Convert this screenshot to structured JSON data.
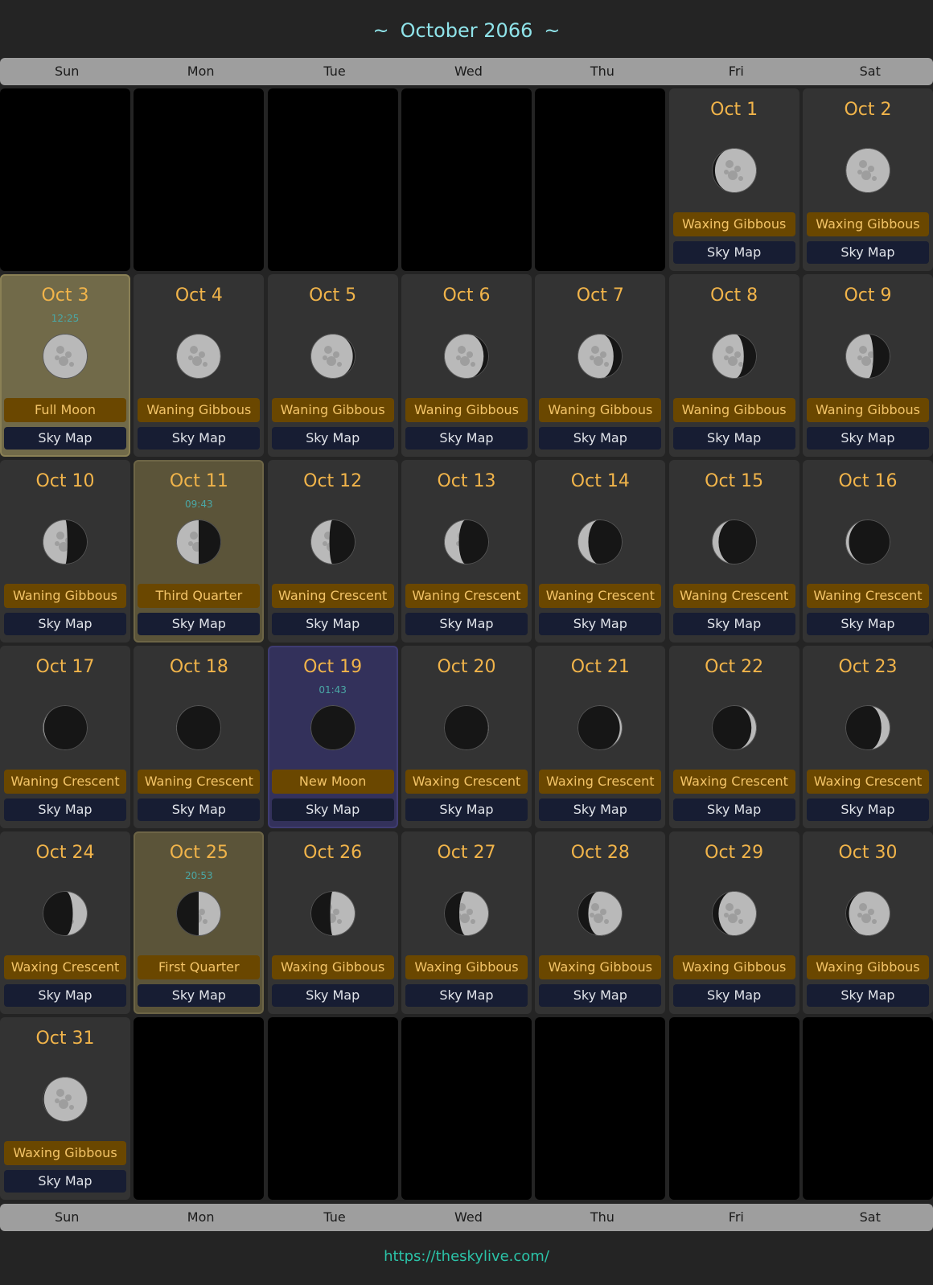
{
  "title": "October 2066",
  "title_deco": "~",
  "weekdays": [
    "Sun",
    "Mon",
    "Tue",
    "Wed",
    "Thu",
    "Fri",
    "Sat"
  ],
  "sky_map_label": "Sky Map",
  "footer_link": "https://theskylive.com/",
  "colors": {
    "date": "#f1b44a",
    "phase_bg": "#6a4700",
    "skymap_bg": "#171d33",
    "title": "#8fe3e9",
    "link": "#2bc3a8"
  },
  "leading_empty": 5,
  "trailing_empty": 6,
  "days": [
    {
      "date": "Oct 1",
      "phase": "Waxing Gibbous",
      "illum": 0.93,
      "waxing": true
    },
    {
      "date": "Oct 2",
      "phase": "Waxing Gibbous",
      "illum": 0.98,
      "waxing": true
    },
    {
      "date": "Oct 3",
      "phase": "Full Moon",
      "time": "12:25",
      "illum": 1.0,
      "waxing": true,
      "highlight": "full"
    },
    {
      "date": "Oct 4",
      "phase": "Waning Gibbous",
      "illum": 0.98,
      "waxing": false
    },
    {
      "date": "Oct 5",
      "phase": "Waning Gibbous",
      "illum": 0.94,
      "waxing": false
    },
    {
      "date": "Oct 6",
      "phase": "Waning Gibbous",
      "illum": 0.88,
      "waxing": false
    },
    {
      "date": "Oct 7",
      "phase": "Waning Gibbous",
      "illum": 0.8,
      "waxing": false
    },
    {
      "date": "Oct 8",
      "phase": "Waning Gibbous",
      "illum": 0.71,
      "waxing": false
    },
    {
      "date": "Oct 9",
      "phase": "Waning Gibbous",
      "illum": 0.62,
      "waxing": false
    },
    {
      "date": "Oct 10",
      "phase": "Waning Gibbous",
      "illum": 0.55,
      "waxing": false
    },
    {
      "date": "Oct 11",
      "phase": "Third Quarter",
      "time": "09:43",
      "illum": 0.5,
      "waxing": false,
      "highlight": "quarter"
    },
    {
      "date": "Oct 12",
      "phase": "Waning Crescent",
      "illum": 0.42,
      "waxing": false
    },
    {
      "date": "Oct 13",
      "phase": "Waning Crescent",
      "illum": 0.33,
      "waxing": false
    },
    {
      "date": "Oct 14",
      "phase": "Waning Crescent",
      "illum": 0.24,
      "waxing": false
    },
    {
      "date": "Oct 15",
      "phase": "Waning Crescent",
      "illum": 0.15,
      "waxing": false
    },
    {
      "date": "Oct 16",
      "phase": "Waning Crescent",
      "illum": 0.08,
      "waxing": false
    },
    {
      "date": "Oct 17",
      "phase": "Waning Crescent",
      "illum": 0.03,
      "waxing": false
    },
    {
      "date": "Oct 18",
      "phase": "Waning Crescent",
      "illum": 0.01,
      "waxing": false
    },
    {
      "date": "Oct 19",
      "phase": "New Moon",
      "time": "01:43",
      "illum": 0.0,
      "waxing": true,
      "highlight": "new"
    },
    {
      "date": "Oct 20",
      "phase": "Waxing Crescent",
      "illum": 0.02,
      "waxing": true
    },
    {
      "date": "Oct 21",
      "phase": "Waxing Crescent",
      "illum": 0.06,
      "waxing": true
    },
    {
      "date": "Oct 22",
      "phase": "Waxing Crescent",
      "illum": 0.12,
      "waxing": true
    },
    {
      "date": "Oct 23",
      "phase": "Waxing Crescent",
      "illum": 0.2,
      "waxing": true
    },
    {
      "date": "Oct 24",
      "phase": "Waxing Crescent",
      "illum": 0.33,
      "waxing": true
    },
    {
      "date": "Oct 25",
      "phase": "First Quarter",
      "time": "20:53",
      "illum": 0.5,
      "waxing": true,
      "highlight": "quarter"
    },
    {
      "date": "Oct 26",
      "phase": "Waxing Gibbous",
      "illum": 0.56,
      "waxing": true
    },
    {
      "date": "Oct 27",
      "phase": "Waxing Gibbous",
      "illum": 0.66,
      "waxing": true
    },
    {
      "date": "Oct 28",
      "phase": "Waxing Gibbous",
      "illum": 0.76,
      "waxing": true
    },
    {
      "date": "Oct 29",
      "phase": "Waxing Gibbous",
      "illum": 0.85,
      "waxing": true
    },
    {
      "date": "Oct 30",
      "phase": "Waxing Gibbous",
      "illum": 0.92,
      "waxing": true
    },
    {
      "date": "Oct 31",
      "phase": "Waxing Gibbous",
      "illum": 0.97,
      "waxing": true
    }
  ]
}
